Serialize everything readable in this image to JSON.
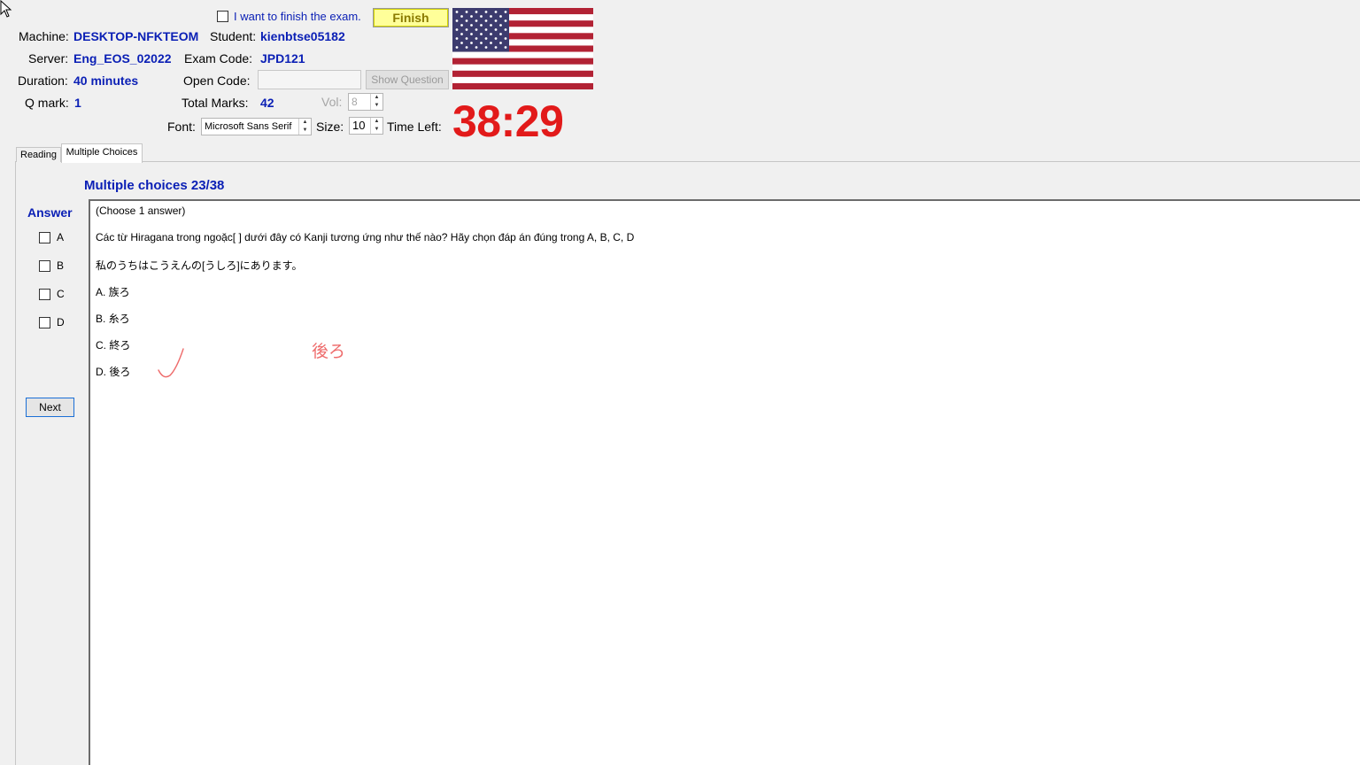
{
  "header": {
    "finish_checkbox_label": "I want to finish the exam.",
    "finish_button": "Finish",
    "machine_label": "Machine:",
    "machine_value": "DESKTOP-NFKTEOM",
    "student_label": "Student:",
    "student_value": "kienbtse05182",
    "server_label": "Server:",
    "server_value": "Eng_EOS_02022",
    "exam_code_label": "Exam Code:",
    "exam_code_value": "JPD121",
    "duration_label": "Duration:",
    "duration_value": "40 minutes",
    "open_code_label": "Open Code:",
    "open_code_value": "",
    "show_question_button": "Show Question",
    "qmark_label": "Q mark:",
    "qmark_value": "1",
    "total_marks_label": "Total Marks:",
    "total_marks_value": "42",
    "vol_label": "Vol:",
    "vol_value": "8",
    "font_label": "Font:",
    "font_value": "Microsoft Sans Serif",
    "size_label": "Size:",
    "size_value": "10",
    "time_left_label": "Time Left:",
    "time_left_value": "38:29"
  },
  "tabs": [
    {
      "label": "Reading",
      "active": false
    },
    {
      "label": "Multiple Choices",
      "active": true
    }
  ],
  "main": {
    "title": "Multiple choices 23/38",
    "answer_title": "Answer",
    "answer_options": [
      "A",
      "B",
      "C",
      "D"
    ],
    "next_button": "Next",
    "question": {
      "instruction": "(Choose 1 answer)",
      "prompt": "Các từ Hiragana trong ngoặc[  ] dưới đây có Kanji tương ứng như thế nào? Hãy chọn đáp án đúng trong A, B, C, D",
      "sentence": "私のうちはこうえんの[うしろ]にあります。",
      "choices": [
        "A.  族ろ",
        "B.  糸ろ",
        "C.  終ろ",
        "D.  後ろ"
      ]
    },
    "handwritten_note": "後ろ"
  },
  "colors": {
    "accent_blue": "#0a1fb5",
    "timer_red": "#e21a1a",
    "finish_bg": "#ffff99",
    "annotation_red": "#ee6b6b"
  }
}
